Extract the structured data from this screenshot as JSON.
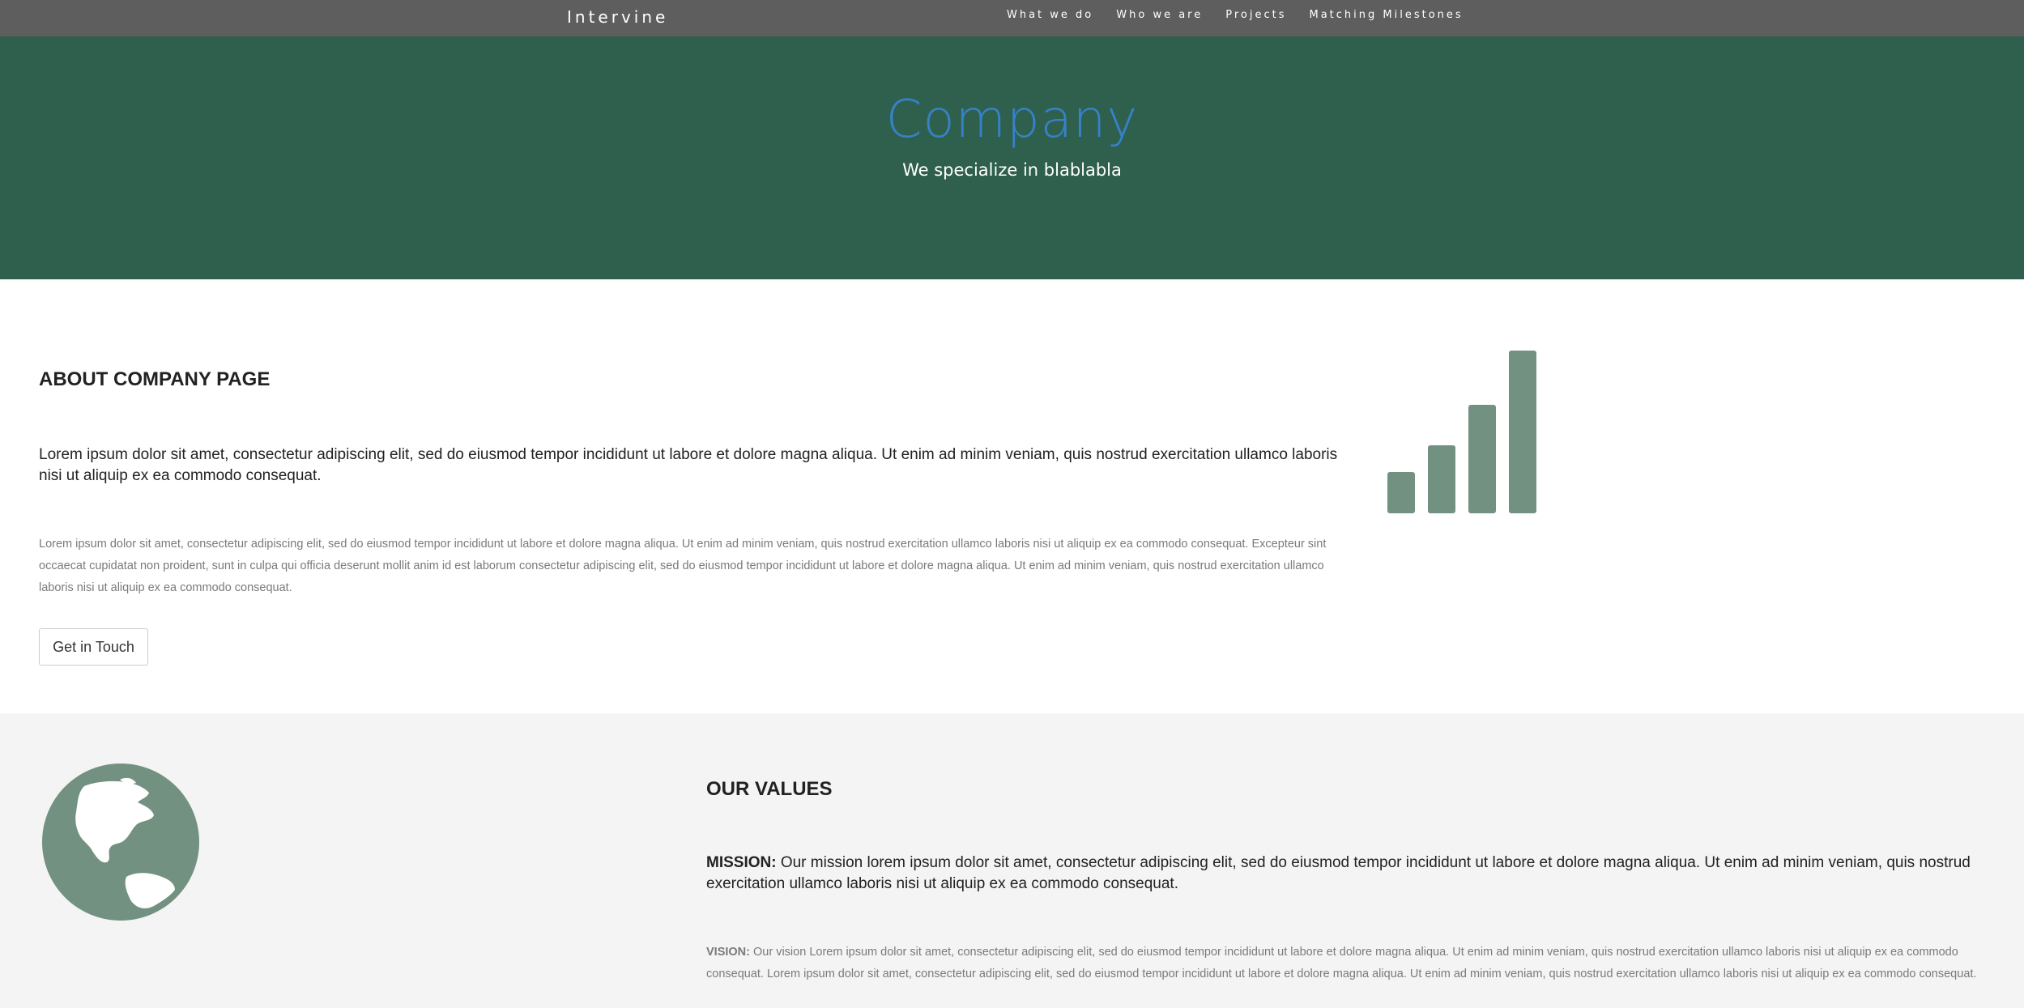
{
  "nav": {
    "brand": "Intervine",
    "links": [
      "What we do",
      "Who we are",
      "Projects",
      "Matching Milestones"
    ]
  },
  "hero": {
    "title": "Company",
    "subtitle": "We specialize in blablabla"
  },
  "about": {
    "heading": "ABOUT COMPANY PAGE",
    "lead": "Lorem ipsum dolor sit amet, consectetur adipiscing elit, sed do eiusmod tempor incididunt ut labore et dolore magna aliqua. Ut enim ad minim veniam, quis nostrud exercitation ullamco laboris nisi ut aliquip ex ea commodo consequat.",
    "body": "Lorem ipsum dolor sit amet, consectetur adipiscing elit, sed do eiusmod tempor incididunt ut labore et dolore magna aliqua. Ut enim ad minim veniam, quis nostrud exercitation ullamco laboris nisi ut aliquip ex ea commodo consequat. Excepteur sint occaecat cupidatat non proident, sunt in culpa qui officia deserunt mollit anim id est laborum consectetur adipiscing elit, sed do eiusmod tempor incididunt ut labore et dolore magna aliqua. Ut enim ad minim veniam, quis nostrud exercitation ullamco laboris nisi ut aliquip ex ea commodo consequat.",
    "button_label": "Get in Touch",
    "icon": "signal-bars-icon"
  },
  "values": {
    "heading": "OUR VALUES",
    "mission_label": "MISSION:",
    "mission_text": " Our mission lorem ipsum dolor sit amet, consectetur adipiscing elit, sed do eiusmod tempor incididunt ut labore et dolore magna aliqua. Ut enim ad minim veniam, quis nostrud exercitation ullamco laboris nisi ut aliquip ex ea commodo consequat.",
    "vision_label": "VISION:",
    "vision_text": " Our vision Lorem ipsum dolor sit amet, consectetur adipiscing elit, sed do eiusmod tempor incididunt ut labore et dolore magna aliqua. Ut enim ad minim veniam, quis nostrud exercitation ullamco laboris nisi ut aliquip ex ea commodo consequat. Lorem ipsum dolor sit amet, consectetur adipiscing elit, sed do eiusmod tempor incididunt ut labore et dolore magna aliqua. Ut enim ad minim veniam, quis nostrud exercitation ullamco laboris nisi ut aliquip ex ea commodo consequat.",
    "icon": "globe-icon"
  },
  "colors": {
    "nav_bg": "#5e5e5e",
    "hero_bg": "#2f5f4d",
    "hero_title": "#3682c9",
    "icon_green": "#739181",
    "values_bg": "#f4f4f4"
  }
}
